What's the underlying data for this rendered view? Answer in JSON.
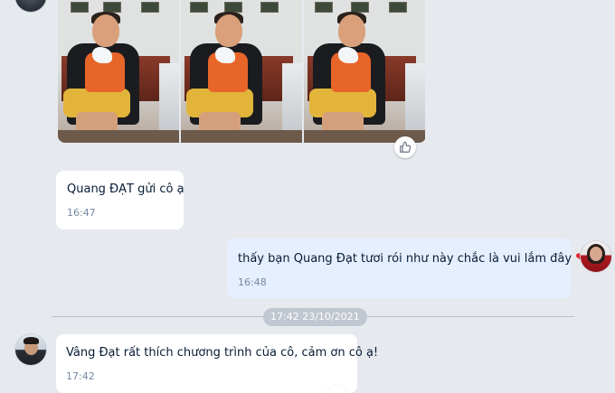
{
  "messages": [
    {
      "id": "m1",
      "direction": "incoming",
      "type": "photos",
      "photo_count": 3,
      "reaction_icon": "thumbs-up-icon"
    },
    {
      "id": "m2",
      "direction": "incoming",
      "text": "Quang ĐẠT gửi cô ạ",
      "time": "16:47"
    },
    {
      "id": "m3",
      "direction": "outgoing",
      "text": "thấy bạn Quang Đạt tươi rói như này chắc là vui lắm đây",
      "emoji": "❤",
      "time": "16:48"
    },
    {
      "id": "m4",
      "direction": "incoming",
      "text": "Vâng Đạt rất thích chương trình của cô, cảm ơn cô ạ!",
      "time": "17:42"
    }
  ],
  "date_separator": "17:42 23/10/2021",
  "icons": {
    "like": "thumbs-up-icon",
    "heart": "heart-icon"
  },
  "colors": {
    "background": "#e6e9ee",
    "incoming_bubble": "#ffffff",
    "outgoing_bubble": "#e5efff",
    "text": "#081c36",
    "time": "#7589a3",
    "heart": "#e0242b"
  }
}
